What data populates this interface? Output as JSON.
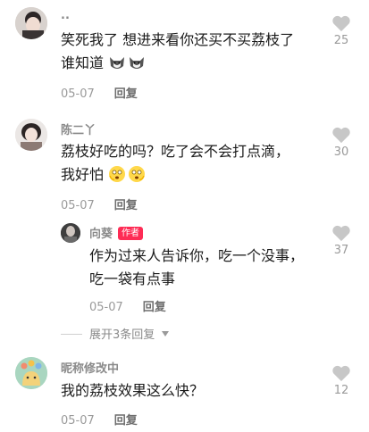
{
  "comments": [
    {
      "username": "..",
      "text_line1": "笑死我了 想进来看你还买不买荔枝了",
      "text_line2": "谁知道",
      "date": "05-07",
      "reply_label": "回复",
      "likes": "25"
    },
    {
      "username": "陈二丫",
      "text_line1": "荔枝好吃的吗？吃了会不会打点滴，",
      "text_line2": "我好怕",
      "date": "05-07",
      "reply_label": "回复",
      "likes": "30"
    },
    {
      "username": "向葵",
      "badge": "作者",
      "text_line1": "作为过来人告诉你，吃一个没事，",
      "text_line2": "吃一袋有点事",
      "date": "05-07",
      "reply_label": "回复",
      "likes": "37"
    },
    {
      "username": "昵称修改中",
      "text_line1": "我的荔枝效果这么快？",
      "date": "05-07",
      "reply_label": "回复",
      "likes": "12"
    }
  ],
  "expand_replies_label": "展开3条回复",
  "icons": {
    "like": "heart-icon",
    "expand": "caret-down-icon",
    "emoji_dog": "husky-emoji-icon",
    "emoji_scared": "scared-face-emoji-icon"
  },
  "colors": {
    "badge": "#fe2c55",
    "heart": "#c7c7c7"
  }
}
